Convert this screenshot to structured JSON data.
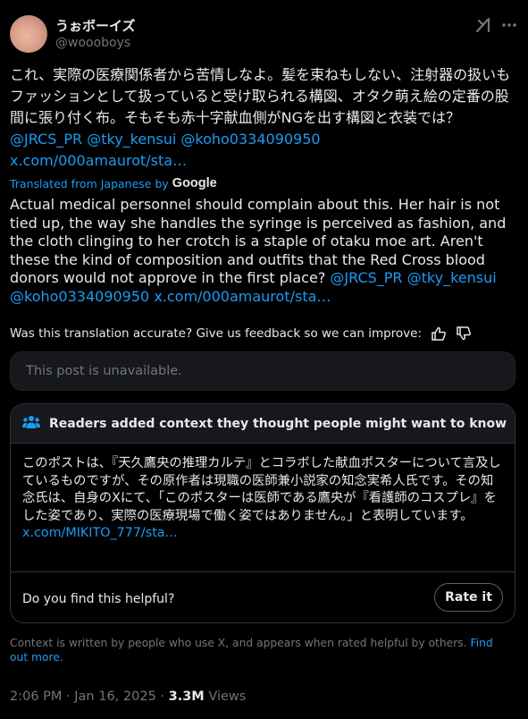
{
  "author": {
    "display_name": "うぉボーイズ",
    "handle": "@woooboys"
  },
  "icons": {
    "grok": "grok-icon",
    "more": "more-dots-icon",
    "thumb_up": "thumbs-up-icon",
    "thumb_down": "thumbs-down-icon",
    "people": "people-icon"
  },
  "post": {
    "original_text": "これ、実際の医療関係者から苦情しなよ。髪を束ねもしない、注射器の扱いもファッションとして扱っていると受け取られる構図、オタク萌え絵の定番の股間に張り付く布。そもそも赤十字献血側がNGを出す構図と衣装では？",
    "mention_jrcs": "@JRCS_PR",
    "mention_tky": "@tky_kensui",
    "mention_koho": "@koho0334090950",
    "link": "x.com/000amaurot/sta…",
    "translated_from": "Translated from Japanese by",
    "translator": "Google",
    "translated_text": "Actual medical personnel should complain about this. Her hair is not tied up, the way she handles the syringe is perceived as fashion, and the cloth clinging to her crotch is a staple of otaku moe art. Aren't these the kind of composition and outfits that the Red Cross blood donors would not approve in the first place?",
    "feedback_question": "Was this translation accurate? Give us feedback so we can improve:"
  },
  "quoted": {
    "unavailable_text": "This post is unavailable."
  },
  "community_note": {
    "header": "Readers added context they thought people might want to know",
    "body": "このポストは、『天久鷹央の推理カルテ』とコラボした献血ポスターについて言及しているものですが、その原作者は現職の医師兼小説家の知念実希人氏です。その知念氏は、自身のXにて、「このポスターは医師である鷹央が『看護師のコスプレ』をした姿であり、実際の医療現場で働く姿ではありません。」と表明しています。",
    "link": "x.com/MIKITO_777/sta…",
    "helpful_question": "Do you find this helpful?",
    "rate_button": "Rate it"
  },
  "context_note": {
    "text": "Context is written by people who use X, and appears when rated helpful by others.",
    "find_out_more": "Find out more."
  },
  "meta": {
    "time": "2:06 PM",
    "date": "Jan 16, 2025",
    "views_count": "3.3M",
    "views_label": "Views"
  },
  "colors": {
    "background": "#000000",
    "text": "#e7e9ea",
    "muted": "#71767b",
    "accent": "#1d9bf0",
    "note_header_icon": "#1d9bf0"
  }
}
